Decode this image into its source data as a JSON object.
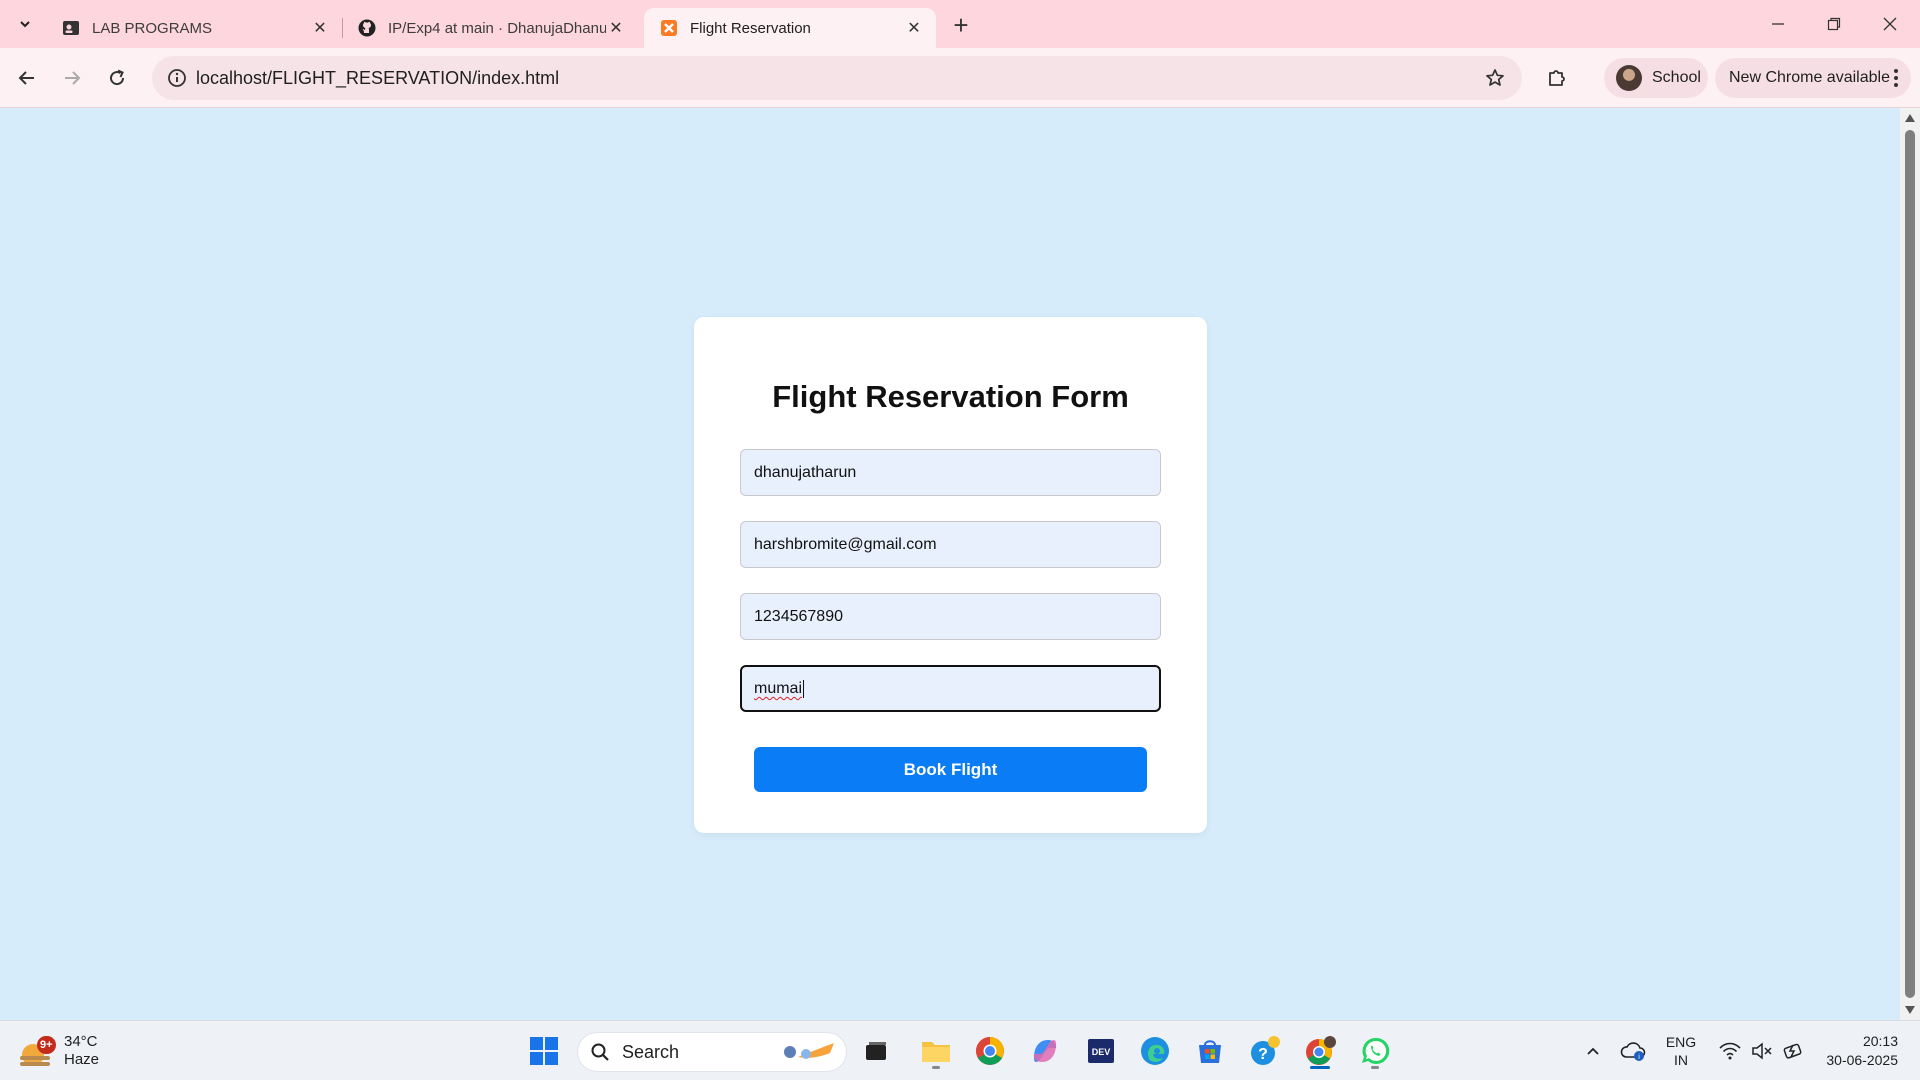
{
  "browser": {
    "tabs": [
      {
        "title": "LAB PROGRAMS",
        "favicon": "contact-card-icon",
        "active": false
      },
      {
        "title": "IP/Exp4 at main · DhanujaDhanu",
        "favicon": "github-icon",
        "active": false
      },
      {
        "title": "Flight Reservation",
        "favicon": "xampp-icon",
        "active": true
      }
    ],
    "url": "localhost/FLIGHT_RESERVATION/index.html",
    "profile_label": "School",
    "update_label": "New Chrome available"
  },
  "form": {
    "title": "Flight Reservation Form",
    "fields": {
      "name": "dhanujatharun",
      "email": "harshbromite@gmail.com",
      "phone": "1234567890",
      "destination": "mumai"
    },
    "submit_label": "Book Flight"
  },
  "taskbar": {
    "weather": {
      "temp": "34°C",
      "condition": "Haze",
      "badge": "9+"
    },
    "search_label": "Search",
    "language": {
      "line1": "ENG",
      "line2": "IN"
    },
    "clock": {
      "time": "20:13",
      "date": "30-06-2025"
    }
  },
  "colors": {
    "page_background": "#d6ecfb",
    "button": "#0a7cf5",
    "tabstrip": "#fdd6de"
  }
}
